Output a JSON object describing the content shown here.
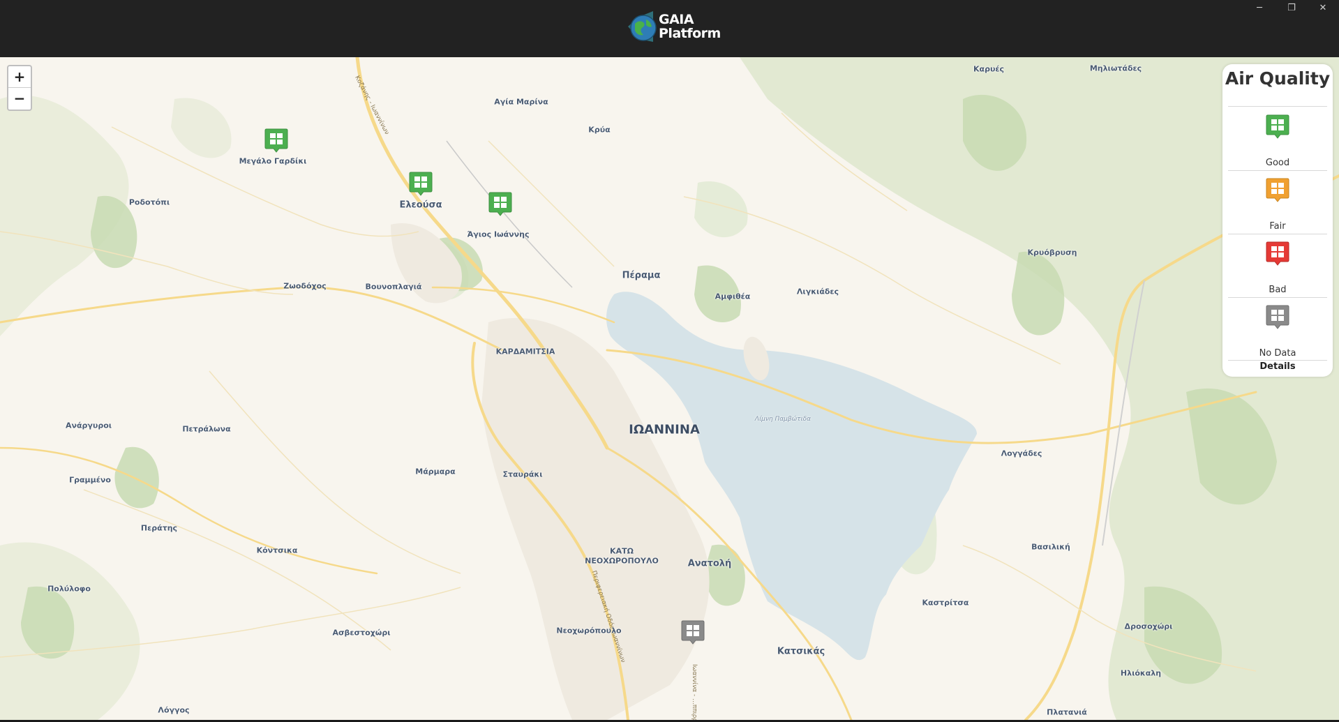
{
  "window": {
    "logo_line1": "GAIA",
    "logo_line2": "Platform",
    "minimize_glyph": "─",
    "restore_glyph": "❐",
    "close_glyph": "✕"
  },
  "zoom": {
    "in_label": "+",
    "out_label": "−"
  },
  "legend": {
    "title": "Air Quality",
    "items": [
      {
        "label": "Good",
        "color": "#4caf50"
      },
      {
        "label": "Fair",
        "color": "#f0a030"
      },
      {
        "label": "Bad",
        "color": "#e53935"
      },
      {
        "label": "No Data",
        "color": "#8a8a8a"
      }
    ],
    "details_label": "Details"
  },
  "places": {
    "karyes": "Καρυές",
    "milotades": "Μηλιωτάδες",
    "agia_marina": "Αγία Μαρίνα",
    "krya": "Κρύα",
    "megalo_gardiki": "Μεγάλο Γαρδίκι",
    "rodotopi": "Ροδοτόπι",
    "eleousa": "Ελεούσα",
    "agios_ioannis": "Άγιος Ιωάννης",
    "perama": "Πέραμα",
    "amfithea": "Αμφιθέα",
    "ligkiades": "Λιγκιάδες",
    "kryovrysi": "Κρυόβρυση",
    "zoodochos": "Ζωοδόχος",
    "vounoplagia": "Βουνοπλαγιά",
    "kardamitsia": "ΚΑΡΔΑΜΙΤΣΙΑ",
    "ioannina": "ΙΩΑΝΝΙΝΑ",
    "limni": "Λίμνη Παμβώτιδα",
    "anargyroi": "Ανάργυροι",
    "petralona": "Πετράλωνα",
    "marmara": "Μάρμαρα",
    "stavraki": "Σταυράκι",
    "loggades": "Λογγάδες",
    "grammeno": "Γραμμένο",
    "peratis": "Περάτης",
    "kontsika": "Κόντσικα",
    "kato_line1": "ΚΑΤΩ",
    "kato_line2": "ΝΕΟΧΩΡΟΠΟΥΛΟ",
    "anatoli": "Ανατολή",
    "vasiliki": "Βασιλική",
    "polylofo": "Πολύλοφο",
    "kastritsa": "Καστρίτσα",
    "neochoropoulo": "Νεοχωρόπουλο",
    "asvestochori": "Ασβεστοχώρι",
    "katsikas": "Κατσικάς",
    "drosochori": "Δροσοχώρι",
    "iliokali": "Ηλιόκαλη",
    "loggos": "Λόγγος",
    "platania": "Πλατανιά"
  },
  "road_labels": {
    "kozanis": "Κοζάνης - Ιωαννίνων",
    "perifereiaki": "Περιφερειακή Οδός Ιωαννίνων",
    "lower": "Ιωαννίνα - ...ππιρρο"
  },
  "markers": [
    {
      "name": "station-megalo-gardiki",
      "status": "good"
    },
    {
      "name": "station-eleousa",
      "status": "good"
    },
    {
      "name": "station-agios-ioannis",
      "status": "good"
    },
    {
      "name": "station-ioannina-south",
      "status": "no-data"
    }
  ]
}
